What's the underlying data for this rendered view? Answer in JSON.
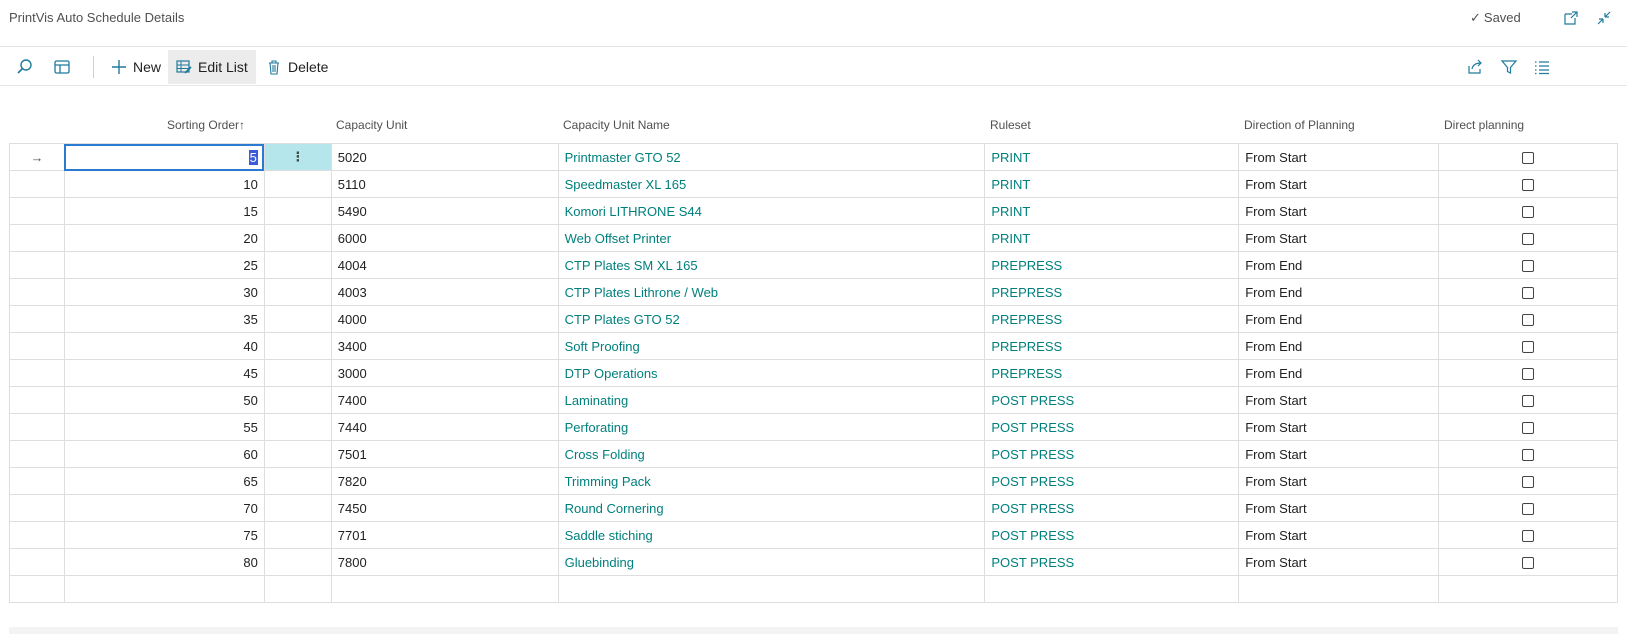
{
  "window": {
    "title": "PrintVis Auto Schedule Details",
    "status": "Saved"
  },
  "toolbar": {
    "new_label": "New",
    "edit_list_label": "Edit List",
    "delete_label": "Delete"
  },
  "columns": {
    "sorting_order": "Sorting Order",
    "capacity_unit": "Capacity Unit",
    "capacity_unit_name": "Capacity Unit Name",
    "ruleset": "Ruleset",
    "direction": "Direction of Planning",
    "direct_planning": "Direct planning"
  },
  "rows": [
    {
      "sorting_order": "5",
      "capacity_unit": "5020",
      "name": "Printmaster GTO 52",
      "ruleset": "PRINT",
      "direction": "From Start",
      "direct_planning": false
    },
    {
      "sorting_order": "10",
      "capacity_unit": "5110",
      "name": "Speedmaster XL 165",
      "ruleset": "PRINT",
      "direction": "From Start",
      "direct_planning": false
    },
    {
      "sorting_order": "15",
      "capacity_unit": "5490",
      "name": "Komori LITHRONE S44",
      "ruleset": "PRINT",
      "direction": "From Start",
      "direct_planning": false
    },
    {
      "sorting_order": "20",
      "capacity_unit": "6000",
      "name": "Web Offset Printer",
      "ruleset": "PRINT",
      "direction": "From Start",
      "direct_planning": false
    },
    {
      "sorting_order": "25",
      "capacity_unit": "4004",
      "name": "CTP Plates SM XL 165",
      "ruleset": "PREPRESS",
      "direction": "From End",
      "direct_planning": false
    },
    {
      "sorting_order": "30",
      "capacity_unit": "4003",
      "name": "CTP Plates Lithrone / Web",
      "ruleset": "PREPRESS",
      "direction": "From End",
      "direct_planning": false
    },
    {
      "sorting_order": "35",
      "capacity_unit": "4000",
      "name": "CTP Plates GTO 52",
      "ruleset": "PREPRESS",
      "direction": "From End",
      "direct_planning": false
    },
    {
      "sorting_order": "40",
      "capacity_unit": "3400",
      "name": "Soft Proofing",
      "ruleset": "PREPRESS",
      "direction": "From End",
      "direct_planning": false
    },
    {
      "sorting_order": "45",
      "capacity_unit": "3000",
      "name": "DTP Operations",
      "ruleset": "PREPRESS",
      "direction": "From End",
      "direct_planning": false
    },
    {
      "sorting_order": "50",
      "capacity_unit": "7400",
      "name": "Laminating",
      "ruleset": "POST PRESS",
      "direction": "From Start",
      "direct_planning": false
    },
    {
      "sorting_order": "55",
      "capacity_unit": "7440",
      "name": "Perforating",
      "ruleset": "POST PRESS",
      "direction": "From Start",
      "direct_planning": false
    },
    {
      "sorting_order": "60",
      "capacity_unit": "7501",
      "name": "Cross Folding",
      "ruleset": "POST PRESS",
      "direction": "From Start",
      "direct_planning": false
    },
    {
      "sorting_order": "65",
      "capacity_unit": "7820",
      "name": "Trimming Pack",
      "ruleset": "POST PRESS",
      "direction": "From Start",
      "direct_planning": false
    },
    {
      "sorting_order": "70",
      "capacity_unit": "7450",
      "name": "Round Cornering",
      "ruleset": "POST PRESS",
      "direction": "From Start",
      "direct_planning": false
    },
    {
      "sorting_order": "75",
      "capacity_unit": "7701",
      "name": "Saddle stiching",
      "ruleset": "POST PRESS",
      "direction": "From Start",
      "direct_planning": false
    },
    {
      "sorting_order": "80",
      "capacity_unit": "7800",
      "name": "Gluebinding",
      "ruleset": "POST PRESS",
      "direction": "From Start",
      "direct_planning": false
    }
  ],
  "colors": {
    "link": "#00807d",
    "selection": "#b4e6ec",
    "focus": "#2b7ad1"
  }
}
